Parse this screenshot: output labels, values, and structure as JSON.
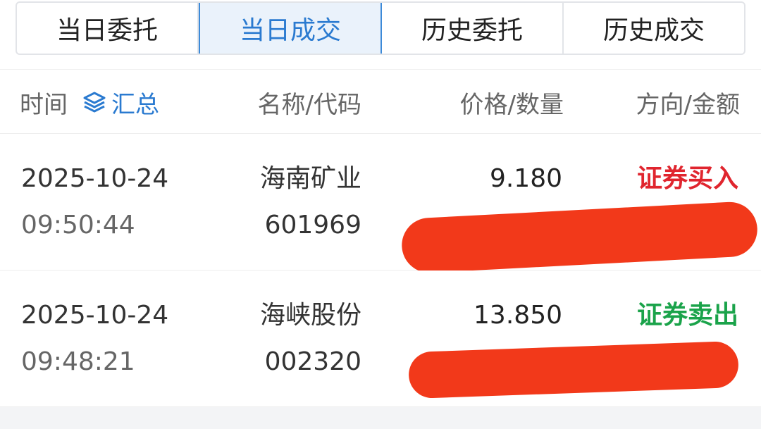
{
  "tabs": [
    {
      "label": "当日委托",
      "active": false
    },
    {
      "label": "当日成交",
      "active": true
    },
    {
      "label": "历史委托",
      "active": false
    },
    {
      "label": "历史成交",
      "active": false
    }
  ],
  "header": {
    "time_label": "时间",
    "summary_label": "汇总",
    "summary_icon": "layers-icon",
    "name_code_label": "名称/代码",
    "price_qty_label": "价格/数量",
    "direction_amount_label": "方向/金额"
  },
  "colors": {
    "accent": "#2a7ad0",
    "buy": "#e0252e",
    "sell": "#1aa34a",
    "redaction": "#f2391a"
  },
  "trades": [
    {
      "date": "2025-10-24",
      "time": "09:50:44",
      "name": "海南矿业",
      "code": "601969",
      "price": "9.180",
      "direction": "证券买入",
      "direction_color": "#e0252e"
    },
    {
      "date": "2025-10-24",
      "time": "09:48:21",
      "name": "海峡股份",
      "code": "002320",
      "price": "13.850",
      "direction": "证券卖出",
      "direction_color": "#1aa34a"
    }
  ]
}
